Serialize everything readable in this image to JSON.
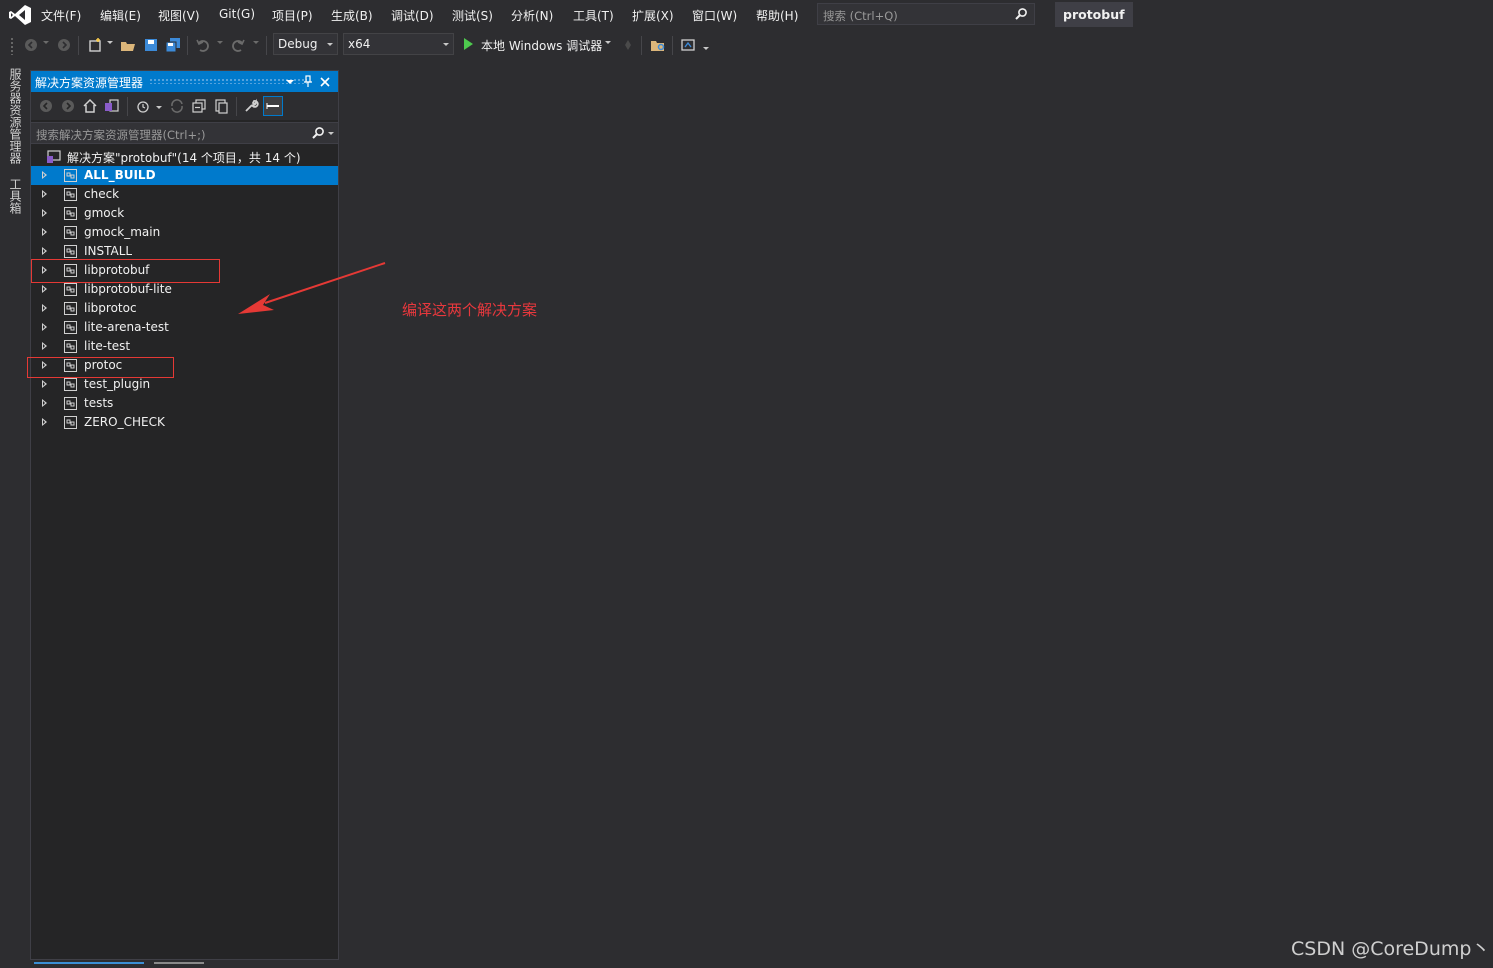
{
  "menu": {
    "items": [
      "文件(F)",
      "编辑(E)",
      "视图(V)",
      "Git(G)",
      "项目(P)",
      "生成(B)",
      "调试(D)",
      "测试(S)",
      "分析(N)",
      "工具(T)",
      "扩展(X)",
      "窗口(W)",
      "帮助(H)"
    ],
    "search_placeholder": "搜索 (Ctrl+Q)",
    "solution_name": "protobuf"
  },
  "toolbar": {
    "configuration": "Debug",
    "platform": "x64",
    "run_label": "本地 Windows 调试器"
  },
  "side_tabs": [
    "服务器资源管理器",
    "工具箱"
  ],
  "solution_explorer": {
    "title": "解决方案资源管理器",
    "search_placeholder": "搜索解决方案资源管理器(Ctrl+;)",
    "solution_label": "解决方案\"protobuf\"(14 个项目，共 14 个)",
    "projects": [
      "ALL_BUILD",
      "check",
      "gmock",
      "gmock_main",
      "INSTALL",
      "libprotobuf",
      "libprotobuf-lite",
      "libprotoc",
      "lite-arena-test",
      "lite-test",
      "protoc",
      "test_plugin",
      "tests",
      "ZERO_CHECK"
    ],
    "selected_project": "ALL_BUILD",
    "highlighted_projects": [
      "libprotobuf",
      "protoc"
    ]
  },
  "annotation": {
    "text": "编译这两个解决方案"
  },
  "watermark": "CSDN @CoreDump丶",
  "colors": {
    "accent": "#007acc",
    "background": "#2d2d30",
    "panel": "#252526",
    "annotation": "#e53935"
  }
}
